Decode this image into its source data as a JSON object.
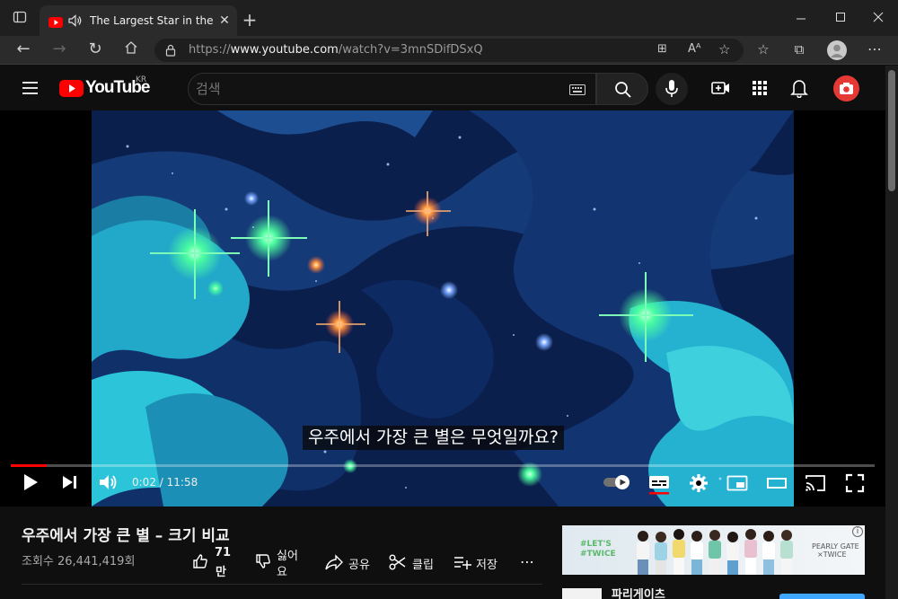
{
  "browser": {
    "tab_title": "The Largest Star in the Univ",
    "url_prefix": "https://",
    "url_domain": "www.youtube.com",
    "url_path": "/watch?v=3mnSDifDSxQ"
  },
  "youtube": {
    "logo_text": "YouTube",
    "region": "KR",
    "search_placeholder": "검색"
  },
  "player": {
    "subtitle": "우주에서 가장 큰 별은 무엇일까요?",
    "time_current": "0:02",
    "time_separator": " / ",
    "time_total": "11:58",
    "progress_fraction": 0.0028
  },
  "video": {
    "title": "우주에서 가장 큰 별 – 크기 비교",
    "views": "조회수 26,441,419회",
    "like_count": "71",
    "like_unit": "만",
    "dislike_label_1": "싫어",
    "dislike_label_2": "요",
    "share_label": "공유",
    "clip_label": "클립",
    "save_label": "저장"
  },
  "sidebar": {
    "ad_text_1": "#LET'S",
    "ad_text_2": "#TWICE",
    "ad_right_1": "PEARLY GATE",
    "ad_right_2": "×TWICE",
    "next_item_partial": "파리게이츠"
  },
  "colors": {
    "youtube_red": "#ff0000",
    "background": "#0f0f0f",
    "sky_deep": "#0a1e48"
  }
}
